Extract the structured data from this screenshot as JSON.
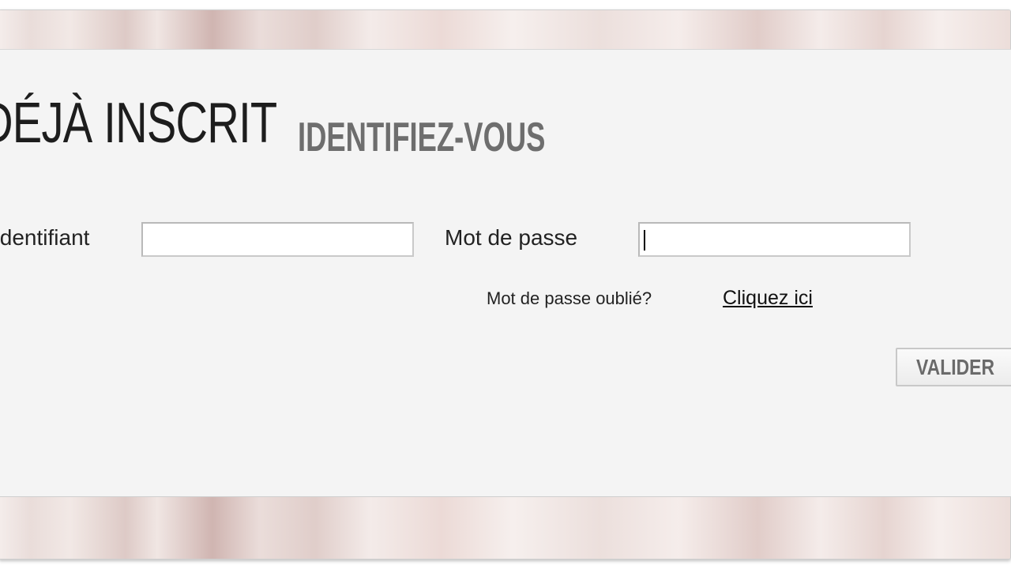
{
  "heading": {
    "main": "DÉJÀ INSCRIT",
    "sub": "IDENTIFIEZ-VOUS"
  },
  "form": {
    "identifiant_label": "Identifiant",
    "identifiant_value": "",
    "password_label": "Mot de passe",
    "password_value": "",
    "forgot_text": "Mot de passe oublié?",
    "forgot_link": "Cliquez ici",
    "submit_label": "VALIDER"
  },
  "colors": {
    "panel_background": "#f4f4f4",
    "title_primary": "#1d1d1d",
    "title_secondary": "#6e6e6e",
    "button_text": "#6a6a6a"
  }
}
